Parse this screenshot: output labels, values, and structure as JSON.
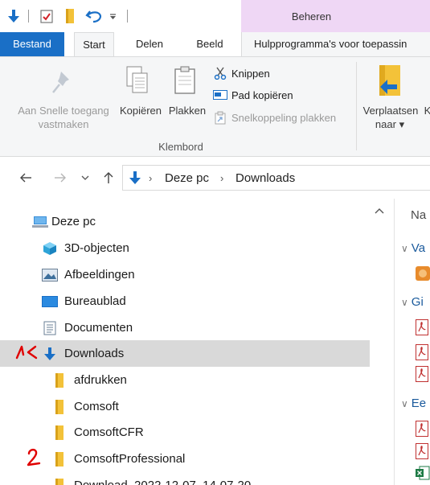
{
  "titlebar": {
    "manage_tab": "Beheren",
    "quick_access": [
      "down-arrow-icon",
      "properties-check-icon",
      "new-folder-icon",
      "undo-icon",
      "customize-dropdown-icon"
    ]
  },
  "tabs": {
    "file": "Bestand",
    "start": "Start",
    "share": "Delen",
    "view": "Beeld",
    "tools": "Hulpprogramma's voor toepassin"
  },
  "ribbon": {
    "pin_label_line1": "Aan Snelle toegang",
    "pin_label_line2": "vastmaken",
    "copy_label": "Kopiëren",
    "paste_label": "Plakken",
    "cut_label": "Knippen",
    "copy_path_label": "Pad kopiëren",
    "paste_shortcut_label": "Snelkoppeling plakken",
    "group_label": "Klembord",
    "move_label_line1": "Verplaatsen",
    "move_label_line2": "naar",
    "move_dropdown": "▾",
    "next_partial": "K"
  },
  "address": {
    "crumbs": [
      "Deze pc",
      "Downloads"
    ],
    "separator": "›"
  },
  "navpane": {
    "items": [
      {
        "label": "Deze pc",
        "icon": "this-pc-icon"
      },
      {
        "label": "3D-objecten",
        "icon": "3d-objects-icon"
      },
      {
        "label": "Afbeeldingen",
        "icon": "pictures-icon"
      },
      {
        "label": "Bureaublad",
        "icon": "desktop-icon"
      },
      {
        "label": "Documenten",
        "icon": "documents-icon"
      },
      {
        "label": "Downloads",
        "icon": "downloads-icon"
      },
      {
        "label": "afdrukken",
        "icon": "folder-icon"
      },
      {
        "label": "Comsoft",
        "icon": "folder-icon"
      },
      {
        "label": "ComsoftCFR",
        "icon": "folder-icon"
      },
      {
        "label": "ComsoftProfessional",
        "icon": "folder-icon"
      },
      {
        "label": "Download_2022-12-07_14-07-20",
        "icon": "folder-icon"
      }
    ],
    "annotations": {
      "downloads_mark": "1",
      "comsoftprofessional_mark": "2"
    }
  },
  "content": {
    "column_name": "Na",
    "groups": [
      "Va",
      "Gi",
      "Ee"
    ]
  },
  "colors": {
    "accent": "#1a6fc6",
    "manage_band": "#efd7f5",
    "ribbon_bg": "#f5f6f7",
    "selected_row": "#d9d9d9",
    "folder_yellow": "#f3c239",
    "annotation_red": "#e00000"
  }
}
